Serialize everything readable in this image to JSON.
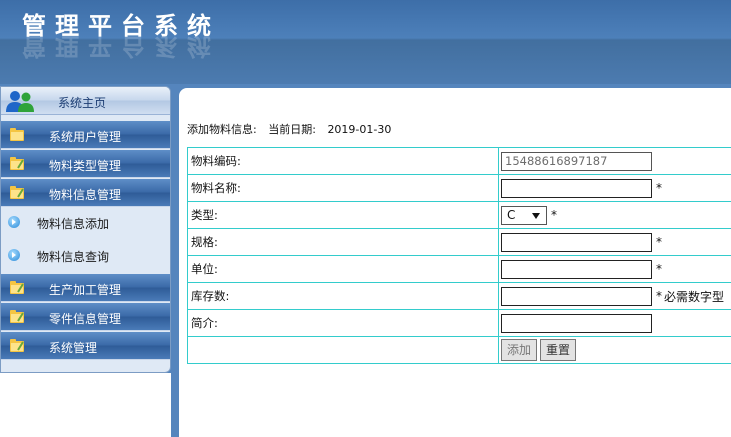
{
  "header": {
    "title": "管理平台系统"
  },
  "sidebar": {
    "home_label": "系统主页",
    "items": [
      {
        "label": "系统用户管理"
      },
      {
        "label": "物料类型管理"
      },
      {
        "label": "物料信息管理"
      }
    ],
    "sub_items": [
      {
        "label": "物料信息添加"
      },
      {
        "label": "物料信息查询"
      }
    ],
    "items_after": [
      {
        "label": "生产加工管理"
      },
      {
        "label": "零件信息管理"
      },
      {
        "label": "系统管理"
      }
    ]
  },
  "main": {
    "info_label": "添加物料信息:",
    "date_label": "当前日期:",
    "date_value": "2019-01-30",
    "fields": {
      "code": {
        "label": "物料编码:",
        "value": "15488616897187"
      },
      "name": {
        "label": "物料名称:",
        "value": "",
        "required": "*"
      },
      "type": {
        "label": "类型:",
        "selected": "C",
        "required": "*"
      },
      "spec": {
        "label": "规格:",
        "value": "",
        "required": "*"
      },
      "unit": {
        "label": "单位:",
        "value": "",
        "required": "*"
      },
      "stock": {
        "label": "库存数:",
        "value": "",
        "required": "*",
        "hint": "必需数字型"
      },
      "intro": {
        "label": "简介:",
        "value": ""
      }
    },
    "buttons": {
      "add": "添加",
      "reset": "重置"
    }
  },
  "colors": {
    "banner": "#4d80ba",
    "nav": "#3b6aa8",
    "table_border": "#33cccc"
  }
}
